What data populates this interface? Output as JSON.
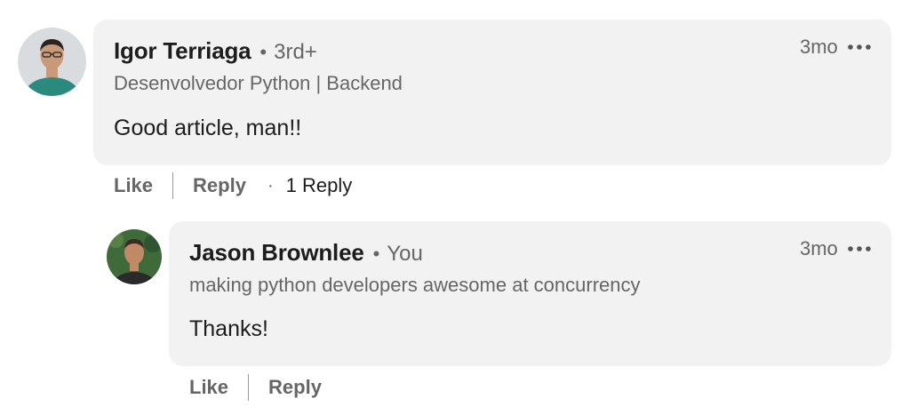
{
  "comments": [
    {
      "author": "Igor Terriaga",
      "degree": "3rd+",
      "headline": "Desenvolvedor Python | Backend",
      "text": "Good article, man!!",
      "time": "3mo",
      "actions": {
        "like": "Like",
        "reply": "Reply",
        "reply_count": "1 Reply"
      },
      "avatar_icon": "person-avatar-icon",
      "colors": {
        "shirt": "#2b8a7e",
        "skin": "#c99a7a",
        "hair": "#2a241f",
        "bg": "#d9dcdf"
      }
    },
    {
      "author": "Jason Brownlee",
      "degree": "You",
      "headline": "making python developers awesome at concurrency",
      "text": "Thanks!",
      "time": "3mo",
      "actions": {
        "like": "Like",
        "reply": "Reply"
      },
      "avatar_icon": "person-avatar-icon",
      "colors": {
        "shirt": "#2a2a2a",
        "skin": "#c08a66",
        "hair": "#3a2b20",
        "bg": "#3f6a3a"
      }
    }
  ],
  "ui": {
    "separator_dot": "•",
    "middle_dot": "·",
    "more_icon": "ellipsis-icon"
  },
  "colors": {
    "bubble_bg": "#f2f2f2",
    "secondary_text": "#666666",
    "primary_text": "#1d1d1d"
  }
}
